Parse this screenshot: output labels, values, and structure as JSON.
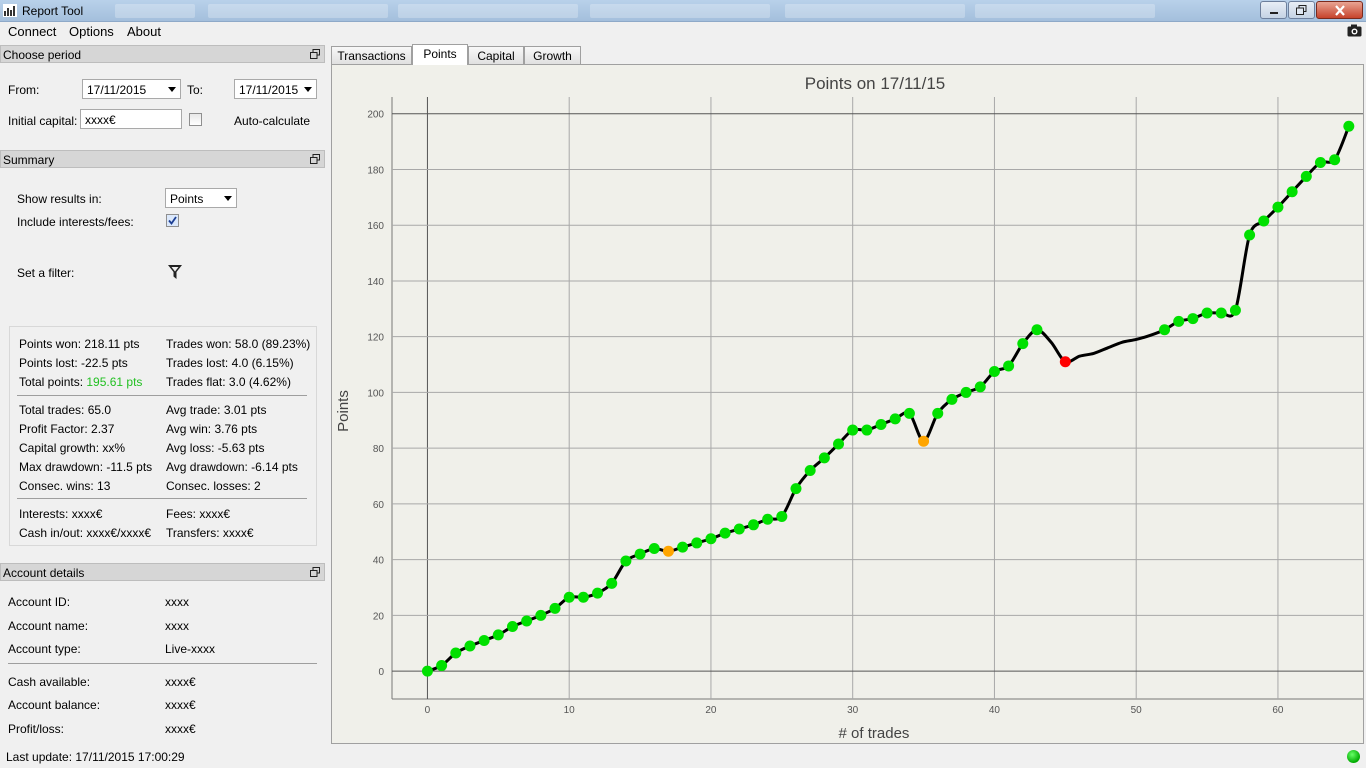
{
  "window": {
    "title": "Report Tool",
    "minimize_icon": "minimize-icon",
    "maximize_icon": "maximize-icon",
    "close_icon": "close-icon"
  },
  "menu": {
    "items": [
      "Connect",
      "Options",
      "About"
    ],
    "camera_icon": "camera-icon"
  },
  "period": {
    "header": "Choose period",
    "from_label": "From:",
    "from_value": "17/11/2015",
    "to_label": "To:",
    "to_value": "17/11/2015",
    "capital_label": "Initial capital:",
    "capital_value": "xxxx€",
    "auto_label": "Auto-calculate"
  },
  "summary": {
    "header": "Summary",
    "show_results_label": "Show results in:",
    "show_results_value": "Points",
    "include_label": "Include interests/fees:",
    "include_checked": true,
    "filter_label": "Set a filter:",
    "filter_icon": "filter-funnel-icon",
    "stats": {
      "points_won": "Points won: 218.11 pts",
      "points_lost": "Points lost: -22.5 pts",
      "total_points_label": "Total points: ",
      "total_points_value": "195.61 pts",
      "trades_won": "Trades won: 58.0 (89.23%)",
      "trades_lost": "Trades lost: 4.0 (6.15%)",
      "trades_flat": "Trades flat: 3.0 (4.62%)",
      "total_trades": "Total trades: 65.0",
      "profit_factor": "Profit Factor: 2.37",
      "capital_growth": "Capital growth: xx%",
      "max_drawdown": "Max drawdown: -11.5 pts",
      "consec_wins": "Consec. wins: 13",
      "avg_trade": "Avg trade: 3.01 pts",
      "avg_win": "Avg win: 3.76 pts",
      "avg_loss": "Avg loss: -5.63 pts",
      "avg_drawdown": "Avg drawdown: -6.14 pts",
      "consec_losses": "Consec. losses: 2",
      "interests": "Interests: xxxx€",
      "cash_inout": "Cash in/out: xxxx€/xxxx€",
      "fees": "Fees: xxxx€",
      "transfers": "Transfers: xxxx€"
    }
  },
  "account": {
    "header": "Account details",
    "id_label": "Account ID:",
    "id_value": "xxxx",
    "name_label": "Account name:",
    "name_value": "xxxx",
    "type_label": "Account type:",
    "type_value": "Live-xxxx",
    "cash_label": "Cash available:",
    "cash_value": "xxxx€",
    "balance_label": "Account balance:",
    "balance_value": "xxxx€",
    "pl_label": "Profit/loss:",
    "pl_value": "xxxx€"
  },
  "status": {
    "last_update": "Last update: 17/11/2015 17:00:29",
    "connected_color": "#22bb22"
  },
  "tabs": [
    "Transactions",
    "Points",
    "Capital",
    "Growth"
  ],
  "active_tab": "Points",
  "colors": {
    "win": "#00e000",
    "flat": "#ffa500",
    "loss": "#ff0000",
    "line": "#000000",
    "green_text": "#22c022"
  },
  "chart_data": {
    "type": "line",
    "title": "Points on 17/11/15",
    "xlabel": "# of trades",
    "ylabel": "Points",
    "xlim": [
      -2.5,
      66
    ],
    "ylim": [
      -10,
      206
    ],
    "xticks": [
      0,
      10,
      20,
      30,
      40,
      50,
      60
    ],
    "yticks": [
      0,
      20,
      40,
      60,
      80,
      100,
      120,
      140,
      160,
      180,
      200
    ],
    "grid": true,
    "line_points": [
      [
        0,
        0
      ],
      [
        1,
        2
      ],
      [
        2,
        6.5
      ],
      [
        3,
        9
      ],
      [
        4,
        11
      ],
      [
        5,
        13
      ],
      [
        6,
        16
      ],
      [
        7,
        18
      ],
      [
        8,
        20
      ],
      [
        9,
        22.5
      ],
      [
        10,
        26.5
      ],
      [
        11,
        26.5
      ],
      [
        12,
        28
      ],
      [
        13,
        31.5
      ],
      [
        14,
        39.5
      ],
      [
        15,
        42
      ],
      [
        16,
        44
      ],
      [
        17,
        43
      ],
      [
        18,
        44.5
      ],
      [
        19,
        46
      ],
      [
        20,
        47.5
      ],
      [
        21,
        49.5
      ],
      [
        22,
        51
      ],
      [
        23,
        52.5
      ],
      [
        24,
        54.5
      ],
      [
        25,
        55.5
      ],
      [
        26,
        65.5
      ],
      [
        27,
        72
      ],
      [
        28,
        76.5
      ],
      [
        29,
        81.5
      ],
      [
        30,
        86.5
      ],
      [
        31,
        86.5
      ],
      [
        32,
        88.5
      ],
      [
        33,
        90.5
      ],
      [
        34,
        92.5
      ],
      [
        35,
        82.5
      ],
      [
        36,
        92.5
      ],
      [
        37,
        97.5
      ],
      [
        38,
        100
      ],
      [
        39,
        102
      ],
      [
        40,
        107.5
      ],
      [
        41,
        109.5
      ],
      [
        42,
        117.5
      ],
      [
        43,
        122.5
      ],
      [
        44,
        118
      ],
      [
        45,
        111
      ],
      [
        46,
        113
      ],
      [
        47,
        114
      ],
      [
        48,
        116
      ],
      [
        49,
        118
      ],
      [
        50,
        119
      ],
      [
        51,
        120.5
      ],
      [
        52,
        122.5
      ],
      [
        53,
        125.5
      ],
      [
        54,
        126.5
      ],
      [
        55,
        128.5
      ],
      [
        56,
        128.5
      ],
      [
        57,
        129.5
      ],
      [
        58,
        156.5
      ],
      [
        59,
        161.5
      ],
      [
        60,
        166.5
      ],
      [
        61,
        172
      ],
      [
        62,
        177.5
      ],
      [
        63,
        182.5
      ],
      [
        64,
        183.5
      ],
      [
        65,
        195.5
      ]
    ],
    "markers": [
      {
        "x": 0,
        "y": 0,
        "kind": "win"
      },
      {
        "x": 1,
        "y": 2,
        "kind": "win"
      },
      {
        "x": 2,
        "y": 6.5,
        "kind": "win"
      },
      {
        "x": 3,
        "y": 9,
        "kind": "win"
      },
      {
        "x": 4,
        "y": 11,
        "kind": "win"
      },
      {
        "x": 5,
        "y": 13,
        "kind": "win"
      },
      {
        "x": 6,
        "y": 16,
        "kind": "win"
      },
      {
        "x": 7,
        "y": 18,
        "kind": "win"
      },
      {
        "x": 8,
        "y": 20,
        "kind": "win"
      },
      {
        "x": 9,
        "y": 22.5,
        "kind": "win"
      },
      {
        "x": 10,
        "y": 26.5,
        "kind": "win"
      },
      {
        "x": 11,
        "y": 26.5,
        "kind": "win"
      },
      {
        "x": 12,
        "y": 28,
        "kind": "win"
      },
      {
        "x": 13,
        "y": 31.5,
        "kind": "win"
      },
      {
        "x": 14,
        "y": 39.5,
        "kind": "win"
      },
      {
        "x": 15,
        "y": 42,
        "kind": "win"
      },
      {
        "x": 16,
        "y": 44,
        "kind": "win"
      },
      {
        "x": 17,
        "y": 43,
        "kind": "flat"
      },
      {
        "x": 18,
        "y": 44.5,
        "kind": "win"
      },
      {
        "x": 19,
        "y": 46,
        "kind": "win"
      },
      {
        "x": 20,
        "y": 47.5,
        "kind": "win"
      },
      {
        "x": 21,
        "y": 49.5,
        "kind": "win"
      },
      {
        "x": 22,
        "y": 51,
        "kind": "win"
      },
      {
        "x": 23,
        "y": 52.5,
        "kind": "win"
      },
      {
        "x": 24,
        "y": 54.5,
        "kind": "win"
      },
      {
        "x": 25,
        "y": 55.5,
        "kind": "win"
      },
      {
        "x": 26,
        "y": 65.5,
        "kind": "win"
      },
      {
        "x": 27,
        "y": 72,
        "kind": "win"
      },
      {
        "x": 28,
        "y": 76.5,
        "kind": "win"
      },
      {
        "x": 29,
        "y": 81.5,
        "kind": "win"
      },
      {
        "x": 30,
        "y": 86.5,
        "kind": "win"
      },
      {
        "x": 31,
        "y": 86.5,
        "kind": "win"
      },
      {
        "x": 32,
        "y": 88.5,
        "kind": "win"
      },
      {
        "x": 33,
        "y": 90.5,
        "kind": "win"
      },
      {
        "x": 34,
        "y": 92.5,
        "kind": "win"
      },
      {
        "x": 35,
        "y": 82.5,
        "kind": "flat"
      },
      {
        "x": 36,
        "y": 92.5,
        "kind": "win"
      },
      {
        "x": 37,
        "y": 97.5,
        "kind": "win"
      },
      {
        "x": 38,
        "y": 100,
        "kind": "win"
      },
      {
        "x": 39,
        "y": 102,
        "kind": "win"
      },
      {
        "x": 40,
        "y": 107.5,
        "kind": "win"
      },
      {
        "x": 41,
        "y": 109.5,
        "kind": "win"
      },
      {
        "x": 42,
        "y": 117.5,
        "kind": "win"
      },
      {
        "x": 43,
        "y": 122.5,
        "kind": "win"
      },
      {
        "x": 45,
        "y": 111,
        "kind": "loss"
      },
      {
        "x": 52,
        "y": 122.5,
        "kind": "win"
      },
      {
        "x": 53,
        "y": 125.5,
        "kind": "win"
      },
      {
        "x": 54,
        "y": 126.5,
        "kind": "win"
      },
      {
        "x": 55,
        "y": 128.5,
        "kind": "win"
      },
      {
        "x": 56,
        "y": 128.5,
        "kind": "win"
      },
      {
        "x": 57,
        "y": 129.5,
        "kind": "win"
      },
      {
        "x": 58,
        "y": 156.5,
        "kind": "win"
      },
      {
        "x": 59,
        "y": 161.5,
        "kind": "win"
      },
      {
        "x": 60,
        "y": 166.5,
        "kind": "win"
      },
      {
        "x": 61,
        "y": 172,
        "kind": "win"
      },
      {
        "x": 62,
        "y": 177.5,
        "kind": "win"
      },
      {
        "x": 63,
        "y": 182.5,
        "kind": "win"
      },
      {
        "x": 64,
        "y": 183.5,
        "kind": "win"
      },
      {
        "x": 65,
        "y": 195.5,
        "kind": "win"
      }
    ]
  }
}
